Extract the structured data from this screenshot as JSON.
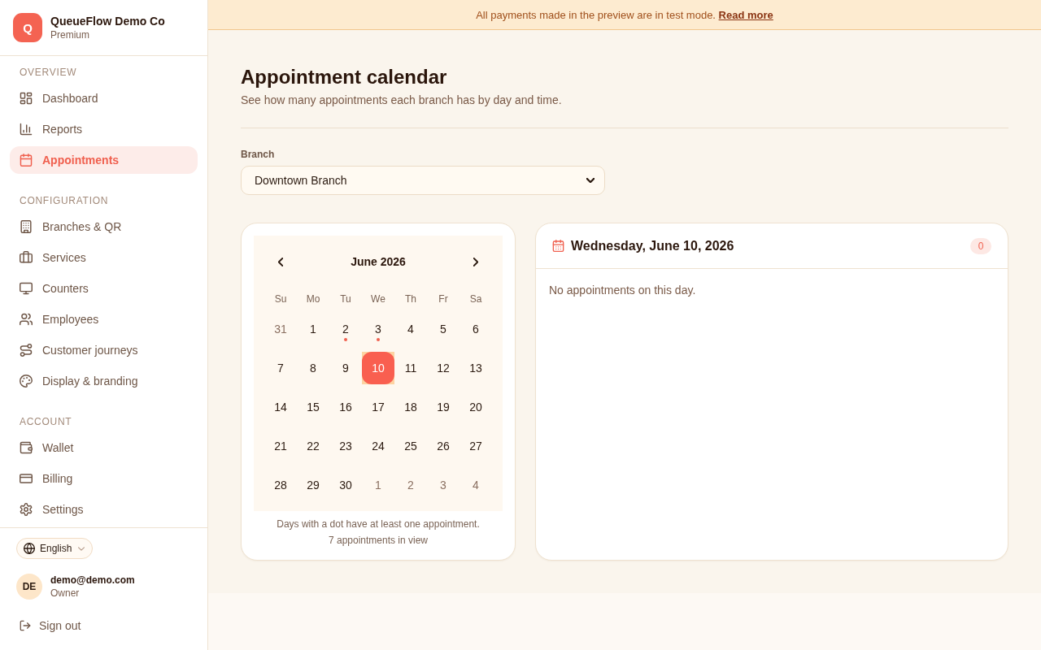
{
  "sidebar": {
    "org": {
      "initial": "Q",
      "name": "QueueFlow Demo Co",
      "plan": "Premium"
    },
    "sections": [
      {
        "title": "OVERVIEW",
        "items": [
          {
            "label": "Dashboard",
            "selected": false
          },
          {
            "label": "Reports",
            "selected": false
          },
          {
            "label": "Appointments",
            "selected": true
          }
        ]
      },
      {
        "title": "CONFIGURATION",
        "items": [
          {
            "label": "Branches & QR",
            "selected": false
          },
          {
            "label": "Services",
            "selected": false
          },
          {
            "label": "Counters",
            "selected": false
          },
          {
            "label": "Employees",
            "selected": false
          },
          {
            "label": "Customer journeys",
            "selected": false
          },
          {
            "label": "Display & branding",
            "selected": false
          }
        ]
      },
      {
        "title": "ACCOUNT",
        "items": [
          {
            "label": "Wallet",
            "selected": false
          },
          {
            "label": "Billing",
            "selected": false
          },
          {
            "label": "Settings",
            "selected": false
          }
        ]
      }
    ],
    "language": "English",
    "user": {
      "initials": "DE",
      "email": "demo@demo.com",
      "role": "Owner"
    },
    "sign_out": "Sign out"
  },
  "banner": {
    "message": "All payments made in the preview are in test mode.",
    "link": "Read more"
  },
  "page": {
    "title": "Appointment calendar",
    "subtitle": "See how many appointments each branch has by day and time."
  },
  "branch_field": {
    "label": "Branch",
    "value": "Downtown Branch"
  },
  "calendar": {
    "month": "June 2026",
    "weekdays": [
      "Su",
      "Mo",
      "Tu",
      "We",
      "Th",
      "Fr",
      "Sa"
    ],
    "weeks": [
      [
        {
          "day": "31",
          "outside_month": true,
          "has_appointments": false,
          "selected": false
        },
        {
          "day": "1",
          "outside_month": false,
          "has_appointments": false,
          "selected": false
        },
        {
          "day": "2",
          "outside_month": false,
          "has_appointments": true,
          "selected": false
        },
        {
          "day": "3",
          "outside_month": false,
          "has_appointments": true,
          "selected": false
        },
        {
          "day": "4",
          "outside_month": false,
          "has_appointments": false,
          "selected": false
        },
        {
          "day": "5",
          "outside_month": false,
          "has_appointments": false,
          "selected": false
        },
        {
          "day": "6",
          "outside_month": false,
          "has_appointments": false,
          "selected": false
        }
      ],
      [
        {
          "day": "7",
          "outside_month": false,
          "has_appointments": false,
          "selected": false
        },
        {
          "day": "8",
          "outside_month": false,
          "has_appointments": false,
          "selected": false
        },
        {
          "day": "9",
          "outside_month": false,
          "has_appointments": false,
          "selected": false
        },
        {
          "day": "10",
          "outside_month": false,
          "has_appointments": false,
          "selected": true
        },
        {
          "day": "11",
          "outside_month": false,
          "has_appointments": false,
          "selected": false
        },
        {
          "day": "12",
          "outside_month": false,
          "has_appointments": false,
          "selected": false
        },
        {
          "day": "13",
          "outside_month": false,
          "has_appointments": false,
          "selected": false
        }
      ],
      [
        {
          "day": "14",
          "outside_month": false,
          "has_appointments": false,
          "selected": false
        },
        {
          "day": "15",
          "outside_month": false,
          "has_appointments": false,
          "selected": false
        },
        {
          "day": "16",
          "outside_month": false,
          "has_appointments": false,
          "selected": false
        },
        {
          "day": "17",
          "outside_month": false,
          "has_appointments": false,
          "selected": false
        },
        {
          "day": "18",
          "outside_month": false,
          "has_appointments": false,
          "selected": false
        },
        {
          "day": "19",
          "outside_month": false,
          "has_appointments": false,
          "selected": false
        },
        {
          "day": "20",
          "outside_month": false,
          "has_appointments": false,
          "selected": false
        }
      ],
      [
        {
          "day": "21",
          "outside_month": false,
          "has_appointments": false,
          "selected": false
        },
        {
          "day": "22",
          "outside_month": false,
          "has_appointments": false,
          "selected": false
        },
        {
          "day": "23",
          "outside_month": false,
          "has_appointments": false,
          "selected": false
        },
        {
          "day": "24",
          "outside_month": false,
          "has_appointments": false,
          "selected": false
        },
        {
          "day": "25",
          "outside_month": false,
          "has_appointments": false,
          "selected": false
        },
        {
          "day": "26",
          "outside_month": false,
          "has_appointments": false,
          "selected": false
        },
        {
          "day": "27",
          "outside_month": false,
          "has_appointments": false,
          "selected": false
        }
      ],
      [
        {
          "day": "28",
          "outside_month": false,
          "has_appointments": false,
          "selected": false
        },
        {
          "day": "29",
          "outside_month": false,
          "has_appointments": false,
          "selected": false
        },
        {
          "day": "30",
          "outside_month": false,
          "has_appointments": false,
          "selected": false
        },
        {
          "day": "1",
          "outside_month": true,
          "has_appointments": false,
          "selected": false
        },
        {
          "day": "2",
          "outside_month": true,
          "has_appointments": false,
          "selected": false
        },
        {
          "day": "3",
          "outside_month": true,
          "has_appointments": false,
          "selected": false
        },
        {
          "day": "4",
          "outside_month": true,
          "has_appointments": false,
          "selected": false
        }
      ]
    ],
    "note": "Days with a dot have at least one appointment.",
    "count": "7 appointments in view"
  },
  "day_panel": {
    "title": "Wednesday, June 10, 2026",
    "count": "0",
    "empty_message": "No appointments on this day."
  }
}
